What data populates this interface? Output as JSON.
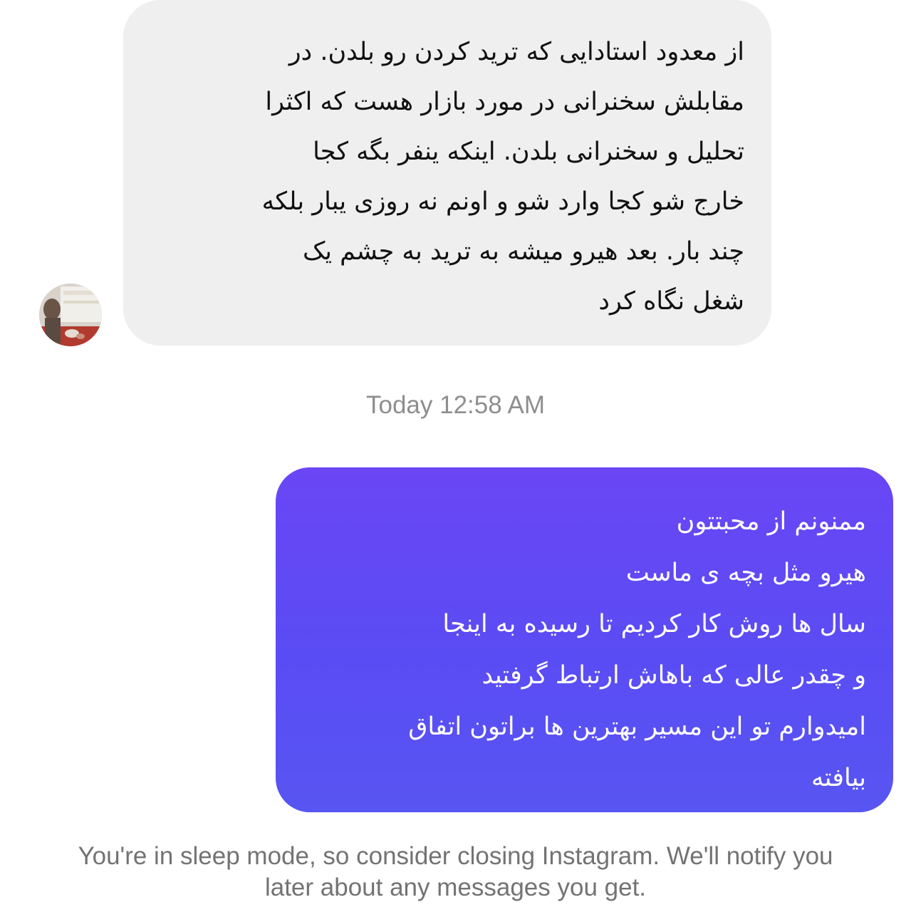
{
  "thread": {
    "incoming_message": {
      "lines": [
        "از معدود استادایی که ترید کردن رو بلدن. در",
        "مقابلش سخنرانی در مورد بازار هست که اکثرا",
        "تحلیل و سخنرانی بلدن. اینکه ینفر بگه کجا",
        "خارج شو کجا وارد شو و اونم نه روزی یبار بلکه",
        "چند بار. بعد هیرو میشه به ترید به چشم یک",
        "شغل نگاه کرد"
      ],
      "bubble_color": "#efefef",
      "text_color": "#111111"
    },
    "timestamp": "Today 12:58 AM",
    "outgoing_message": {
      "lines": [
        "ممنونم از محبتتون",
        "هیرو مثل بچه ی ماست",
        "سال ها روش کار کردیم تا رسیده به اینجا",
        "و چقدر عالی که باهاش ارتباط گرفتید",
        "امیدوارم تو این مسیر بهترین ها براتون اتفاق",
        "بیافته"
      ],
      "bubble_gradient": [
        "#6a46f5",
        "#5855f2"
      ],
      "text_color": "#ffffff"
    },
    "sleep_notice": {
      "line1": "You're in sleep mode, so consider closing Instagram. We'll notify you",
      "line2": "later about any messages you get."
    }
  }
}
